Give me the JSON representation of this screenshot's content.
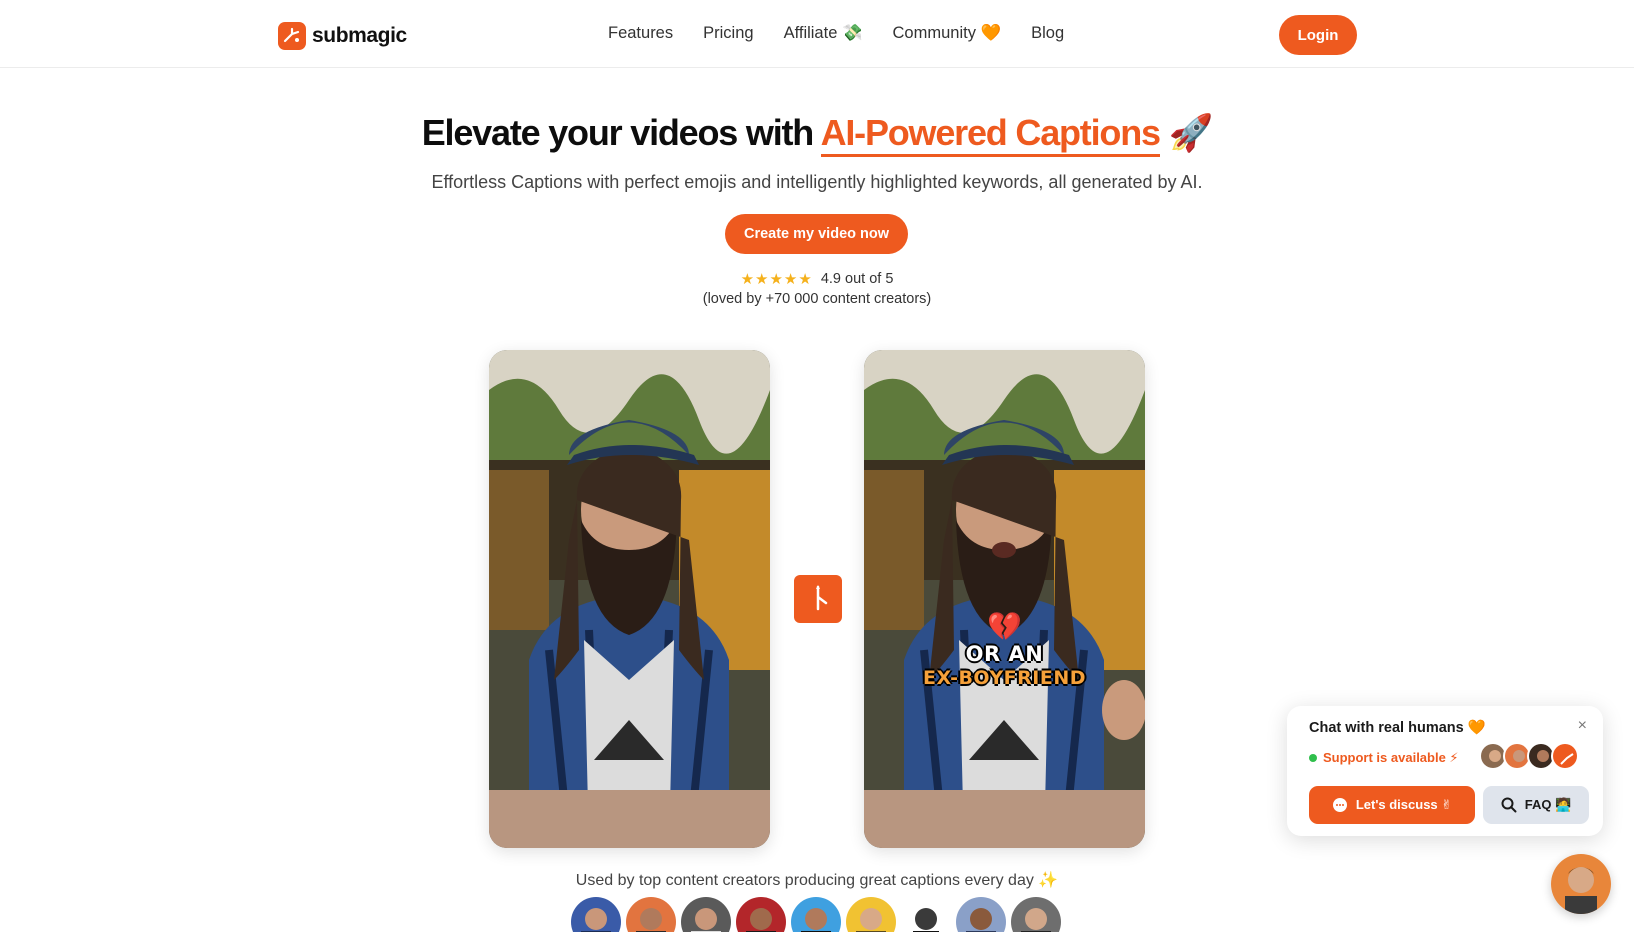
{
  "nav": {
    "logo_text": "submagic",
    "links": [
      "Features",
      "Pricing",
      "Affiliate 💸",
      "Community 🧡",
      "Blog"
    ],
    "login_label": "Login"
  },
  "hero": {
    "title_start": "Elevate your videos with ",
    "title_accent": "AI-Powered Captions",
    "title_emoji": " 🚀",
    "subtitle": "Effortless Captions with perfect emojis and intelligently highlighted keywords, all generated by AI.",
    "cta_label": "Create my video now",
    "stars": "★★★★★",
    "rating_text": "4.9 out of 5",
    "loved_text": "(loved by +70 000 content creators)"
  },
  "video": {
    "caption_emoji": "💔",
    "caption_line1": "OR AN",
    "caption_line2": "EX-BOYFRIEND"
  },
  "creators": {
    "label": "Used by top content creators producing great captions every day ✨"
  },
  "chat": {
    "title": "Chat with real humans 🧡",
    "close": "×",
    "status": "Support is available ⚡",
    "discuss_label": "Let's discuss ✌",
    "faq_label": "FAQ 🧑‍💻"
  },
  "colors": {
    "brand": "#ee5a1f",
    "star": "#f5b11c",
    "status_green": "#2fbf4c"
  }
}
